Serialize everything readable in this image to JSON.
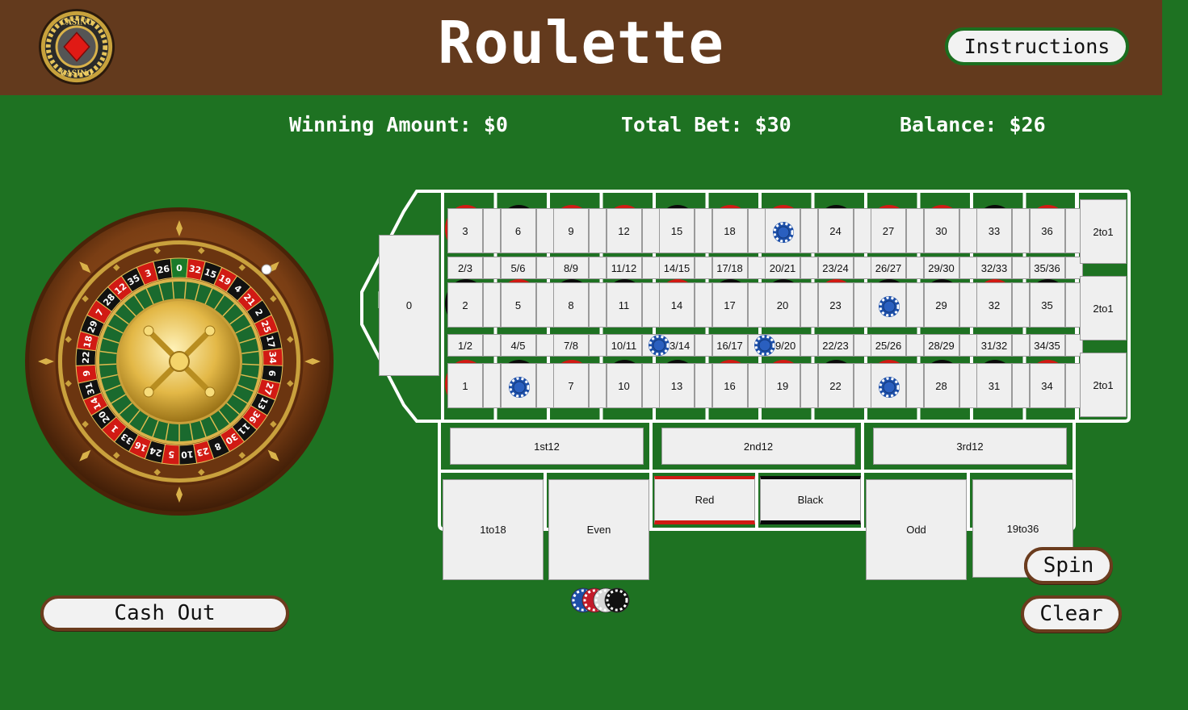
{
  "header": {
    "title": "Roulette",
    "instructions_label": "Instructions",
    "logo_text": "CASINO"
  },
  "stats": {
    "winning": "Winning Amount: $0",
    "total_bet": "Total Bet: $30",
    "balance": "Balance: $26"
  },
  "wheel_numbers": [
    "0",
    "32",
    "15",
    "19",
    "4",
    "21",
    "2",
    "25",
    "17",
    "34",
    "6",
    "27",
    "13",
    "36",
    "11",
    "30",
    "8",
    "23",
    "10",
    "5",
    "24",
    "16",
    "33",
    "1",
    "20",
    "14",
    "31",
    "9",
    "22",
    "18",
    "29",
    "7",
    "28",
    "12",
    "35",
    "3",
    "26"
  ],
  "board": {
    "zero": "0",
    "top_row": [
      "3",
      "6",
      "9",
      "12",
      "15",
      "18",
      "21",
      "24",
      "27",
      "30",
      "33",
      "36"
    ],
    "mid_row": [
      "2",
      "5",
      "8",
      "11",
      "14",
      "17",
      "20",
      "23",
      "26",
      "29",
      "32",
      "35"
    ],
    "bot_row": [
      "1",
      "4",
      "7",
      "10",
      "13",
      "16",
      "19",
      "22",
      "25",
      "28",
      "31",
      "34"
    ],
    "split_upper": [
      "2/3",
      "5/6",
      "8/9",
      "11/12",
      "14/15",
      "17/18",
      "20/21",
      "23/24",
      "26/27",
      "29/30",
      "32/33",
      "35/36"
    ],
    "split_lower": [
      "1/2",
      "4/5",
      "7/8",
      "10/11",
      "13/14",
      "16/17",
      "19/20",
      "22/23",
      "25/26",
      "28/29",
      "31/32",
      "34/35"
    ],
    "column_bets": [
      "2to1",
      "2to1",
      "2to1"
    ],
    "dozens": [
      "1st12",
      "2nd12",
      "3rd12"
    ],
    "outside": [
      "1to18",
      "Even",
      "Red",
      "Black",
      "Odd",
      "19to36"
    ],
    "red_numbers": [
      1,
      3,
      5,
      7,
      9,
      12,
      14,
      16,
      18,
      19,
      21,
      23,
      25,
      27,
      30,
      32,
      34,
      36
    ]
  },
  "placed_chips": [
    "21",
    "26",
    "4",
    "25",
    "10/11",
    "16/17"
  ],
  "controls": {
    "spin_label": "Spin",
    "clear_label": "Clear",
    "cashout_label": "Cash Out"
  },
  "chip_tray": [
    "blue-chip",
    "red-chip",
    "white-chip",
    "black-chip"
  ],
  "colors": {
    "felt": "#1e7222",
    "header": "#633a1d",
    "red": "#d11a14",
    "black": "#0a0a0a",
    "chip_blue": "#1d4fa8"
  }
}
